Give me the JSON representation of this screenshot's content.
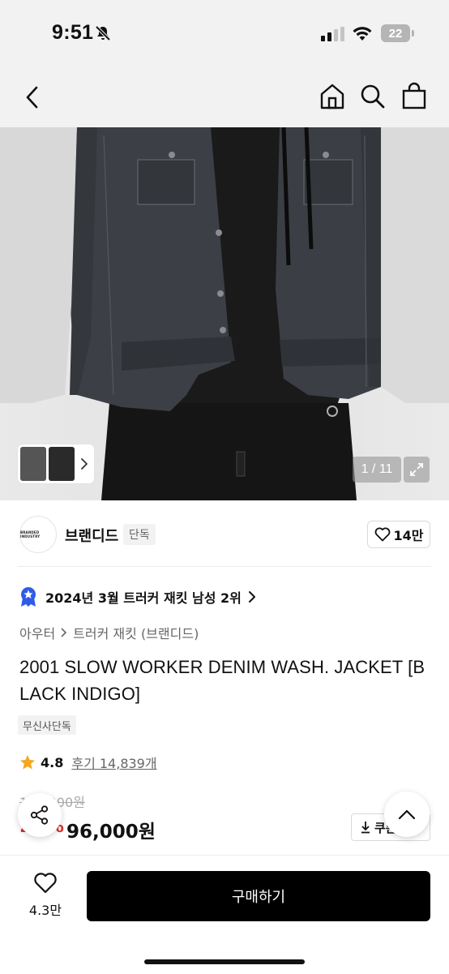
{
  "status_bar": {
    "time": "9:51",
    "battery": "22"
  },
  "hero": {
    "counter": "1 / 11"
  },
  "brand": {
    "logo_text": "BRANDED INDUSTRY",
    "name": "브랜디드",
    "badge": "단독",
    "likes": "14만"
  },
  "ranking": {
    "text": "2024년 3월 트러커 재킷 남성 2위"
  },
  "breadcrumb": {
    "category": "아우터",
    "sub": "트러커 재킷 (브랜디드)"
  },
  "product": {
    "title": "2001 SLOW WORKER DENIM WASH. JACKET [BLACK INDIGO]",
    "exclusive_tag": "무신사단독",
    "rating": "4.8",
    "reviews": "후기 14,839개",
    "original_price": "129,000원",
    "discount": "25%",
    "price": "96,000원",
    "coupon": "쿠폰"
  },
  "bottom": {
    "wish_count": "4.3만",
    "buy_label": "구매하기"
  },
  "colors": {
    "accent": "#e0312c",
    "star": "#f5a623",
    "rank_badge": "#2f5bea"
  }
}
